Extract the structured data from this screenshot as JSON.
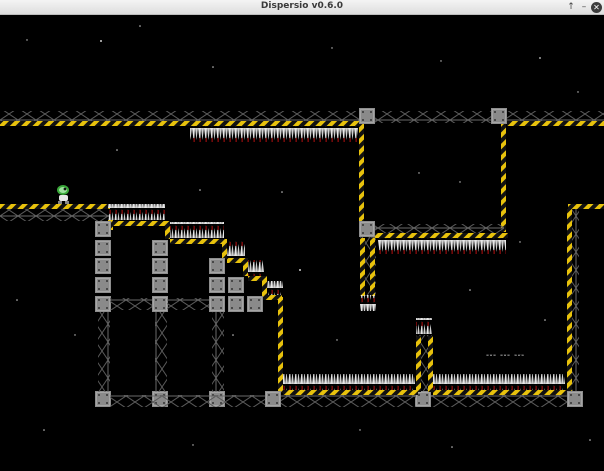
{
  "window": {
    "title": "Dispersio v0.6.0",
    "buttons": {
      "maximize": "↑",
      "minimize": "–",
      "close": "✕"
    }
  },
  "level": {
    "hazard_colors": {
      "stripe_yellow": "#e8c20c",
      "stripe_black": "#111111",
      "spike": "#e6e6e6",
      "blood": "#8b0d0d",
      "block": "#8e8e8e",
      "girder": "#5a5a5a"
    },
    "player": {
      "sprite": "green-frog-astronaut-icon"
    },
    "hint_text": "ʷʷʷ ʷʷʷ ʷʷʷ"
  }
}
